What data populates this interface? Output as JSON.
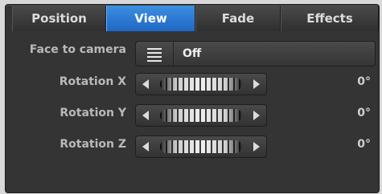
{
  "tabs": [
    {
      "label": "Position"
    },
    {
      "label": "View"
    },
    {
      "label": "Fade"
    },
    {
      "label": "Effects"
    }
  ],
  "face_to_camera": {
    "label": "Face to camera",
    "value": "Off",
    "icon": "list-icon"
  },
  "rotations": [
    {
      "label": "Rotation X",
      "value": "0°"
    },
    {
      "label": "Rotation Y",
      "value": "0°"
    },
    {
      "label": "Rotation Z",
      "value": "0°"
    }
  ],
  "colors": {
    "active_tab": "#2a7ad6",
    "panel_bg": "#343434",
    "label_text": "#b9b9b9"
  }
}
